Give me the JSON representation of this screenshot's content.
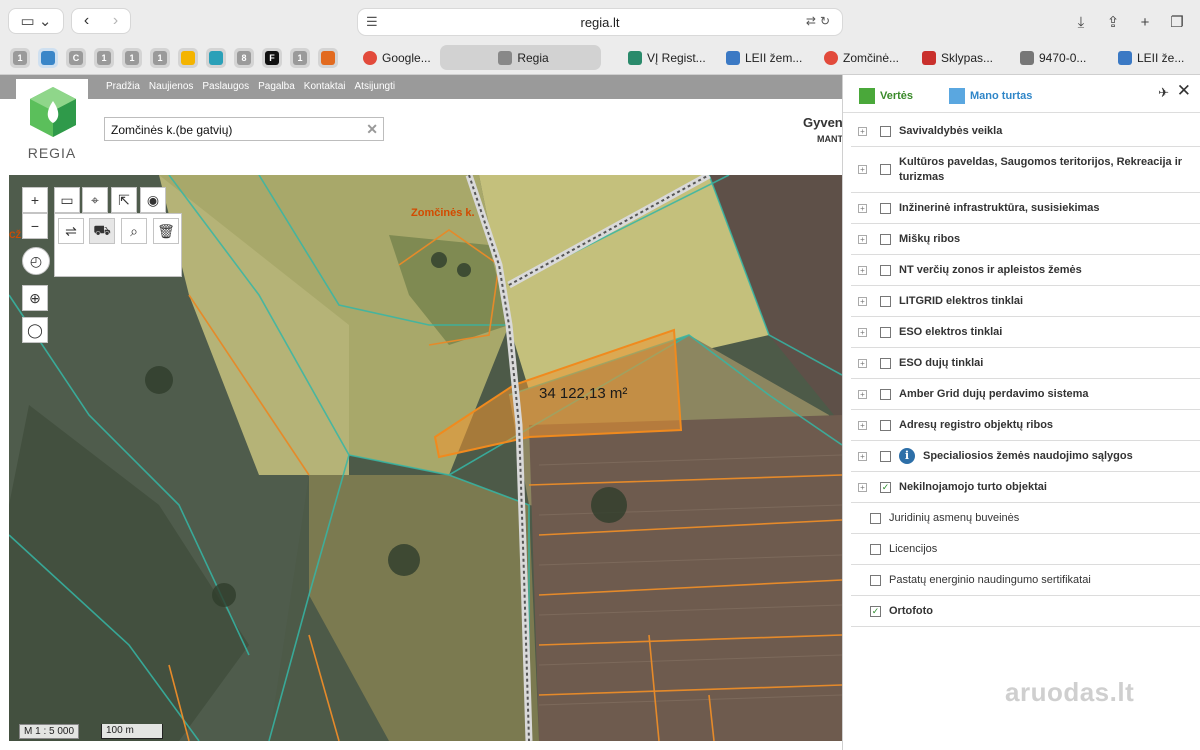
{
  "browser": {
    "url": "regia.lt",
    "pinned_tabs": [
      "1",
      "",
      "C",
      "1",
      "1",
      "1",
      "",
      "",
      "8",
      "F",
      "1",
      ""
    ],
    "tabs": [
      {
        "label": "Google...",
        "color": "#e24a3b"
      },
      {
        "label": "Regia",
        "color": "#888888",
        "active": true
      },
      {
        "label": "VĮ Regist...",
        "color": "#2a8a6b"
      },
      {
        "label": "LEII žem...",
        "color": "#3b79c4"
      },
      {
        "label": "Zomčinė...",
        "color": "#e24a3b"
      },
      {
        "label": "Sklypas...",
        "color": "#c9302c"
      },
      {
        "label": "9470-0...",
        "color": "#777777"
      },
      {
        "label": "LEII že...",
        "color": "#3b79c4"
      }
    ]
  },
  "site": {
    "nav": [
      "Pradžia",
      "Naujienos",
      "Paslaugos",
      "Pagalba",
      "Kontaktai",
      "Atsijungti"
    ],
    "logo_text": "REGIA",
    "search_value": "Zomčinės k.(be gatvių)",
    "header_right_title": "Gyven",
    "header_right_sub": "MANT"
  },
  "map": {
    "village_label": "Zomčinės k.",
    "area_label": "34 122,13 m²",
    "scale_text": "M 1 : 5 000",
    "scale_bar_text": "100 m",
    "left_edge_label": "CŽ"
  },
  "panel": {
    "tab_values": "Vertės",
    "tab_property": "Mano turtas",
    "layers": [
      {
        "label": "Savivaldybės veikla",
        "expandable": true,
        "checked": false
      },
      {
        "label": "Kultūros paveldas, Saugomos teritorijos, Rekreacija ir turizmas",
        "expandable": true,
        "checked": false
      },
      {
        "label": "Inžinerinė infrastruktūra, susisiekimas",
        "expandable": true,
        "checked": false
      },
      {
        "label": "Miškų ribos",
        "expandable": true,
        "checked": false
      },
      {
        "label": "NT verčių zonos ir apleistos žemės",
        "expandable": true,
        "checked": false
      },
      {
        "label": "LITGRID elektros tinklai",
        "expandable": true,
        "checked": false
      },
      {
        "label": "ESO elektros tinklai",
        "expandable": true,
        "checked": false
      },
      {
        "label": "ESO dujų tinklai",
        "expandable": true,
        "checked": false
      },
      {
        "label": "Amber Grid dujų perdavimo sistema",
        "expandable": true,
        "checked": false
      },
      {
        "label": "Adresų registro objektų ribos",
        "expandable": true,
        "checked": false
      },
      {
        "label": "Specialiosios žemės naudojimo sąlygos",
        "expandable": true,
        "checked": false,
        "info": true
      },
      {
        "label": "Nekilnojamojo turto objektai",
        "expandable": true,
        "checked": true
      },
      {
        "label": "Juridinių asmenų buveinės",
        "expandable": false,
        "checked": false
      },
      {
        "label": "Licencijos",
        "expandable": false,
        "checked": false
      },
      {
        "label": "Pastatų energinio naudingumo sertifikatai",
        "expandable": false,
        "checked": false
      },
      {
        "label": "Ortofoto",
        "expandable": false,
        "checked": true
      }
    ],
    "watermark": "aruodas.lt"
  }
}
